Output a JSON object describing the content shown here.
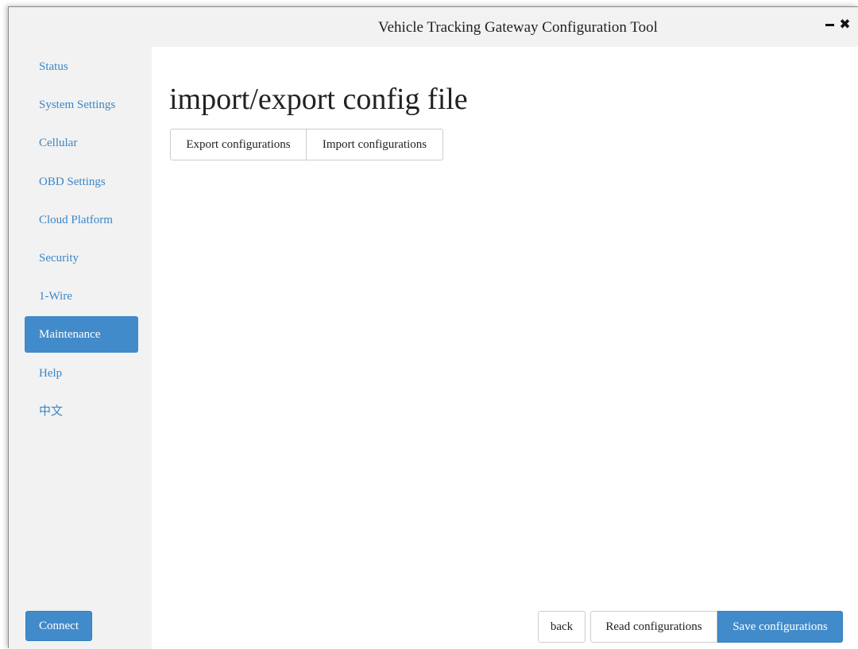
{
  "window": {
    "title": "Vehicle Tracking Gateway Configuration Tool",
    "controls": {
      "minimize_icon": "minimize-icon",
      "close_icon": "close-icon",
      "close_glyph": "✖"
    }
  },
  "sidebar": {
    "items": [
      {
        "label": "Status",
        "active": false
      },
      {
        "label": "System Settings",
        "active": false
      },
      {
        "label": "Cellular",
        "active": false
      },
      {
        "label": "OBD Settings",
        "active": false
      },
      {
        "label": "Cloud Platform",
        "active": false
      },
      {
        "label": "Security",
        "active": false
      },
      {
        "label": "1-Wire",
        "active": false
      },
      {
        "label": "Maintenance",
        "active": true
      },
      {
        "label": "Help",
        "active": false
      },
      {
        "label": "中文",
        "active": false
      }
    ],
    "connect_label": "Connect"
  },
  "main": {
    "title": "import/export config file",
    "export_label": "Export configurations",
    "import_label": "Import configurations"
  },
  "footer": {
    "back_label": "back",
    "read_label": "Read configurations",
    "save_label": "Save configurations"
  },
  "colors": {
    "accent": "#428bca",
    "link": "#3a86c8",
    "sidebar_bg": "#f2f2f2",
    "content_bg": "#ffffff"
  }
}
